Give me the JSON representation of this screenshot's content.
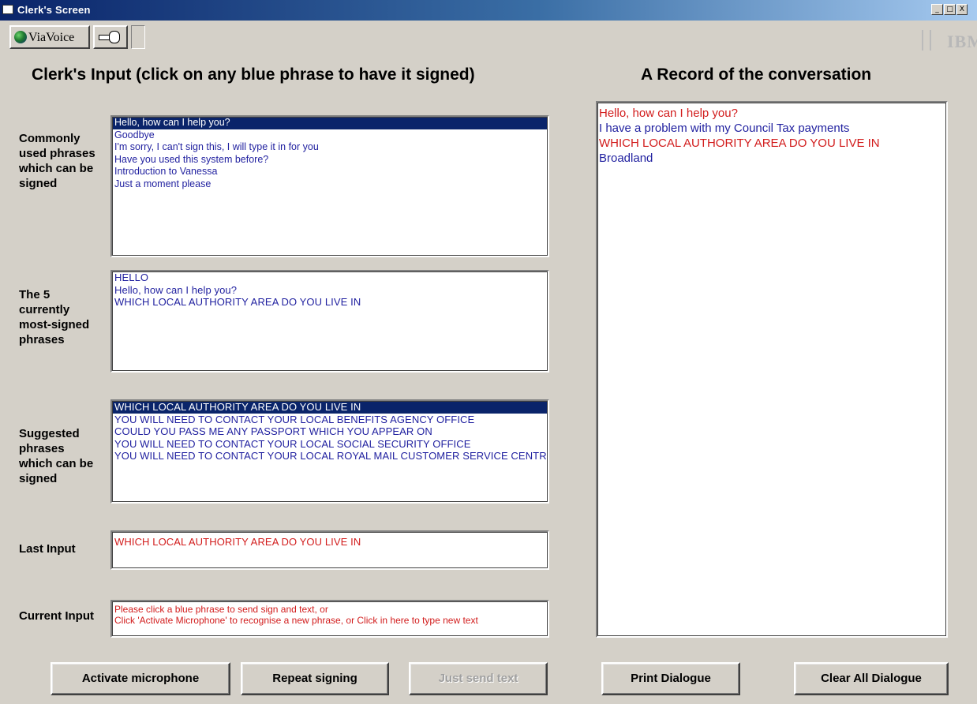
{
  "window": {
    "title": "Clerk's Screen",
    "controls": [
      "_",
      "□",
      "X"
    ]
  },
  "toolbar": {
    "viavoice_label": "ViaVoice",
    "logo_text": "IBM"
  },
  "headings": {
    "input": "Clerk's Input (click on any blue phrase to have it signed)",
    "record": "A Record of the conversation"
  },
  "sections": {
    "common": "Commonly used phrases which can be signed",
    "most_signed": "The 5 currently most-signed phrases",
    "suggested": "Suggested phrases which can be signed",
    "last_input": "Last Input",
    "current_input": "Current Input"
  },
  "common_phrases": [
    "Hello, how can I help you?",
    "Goodbye",
    "I'm sorry, I can't sign this, I will type it in for you",
    "Have you used this system before?",
    "Introduction to Vanessa",
    "Just a moment please"
  ],
  "most_signed": [
    "HELLO",
    "Hello, how can I help you?",
    "WHICH LOCAL AUTHORITY AREA DO YOU LIVE IN"
  ],
  "suggested": [
    "WHICH LOCAL AUTHORITY AREA DO YOU LIVE IN",
    "YOU WILL NEED TO CONTACT YOUR LOCAL BENEFITS AGENCY OFFICE",
    "COULD YOU PASS ME ANY PASSPORT WHICH YOU APPEAR ON",
    "YOU WILL NEED TO CONTACT YOUR LOCAL SOCIAL SECURITY OFFICE",
    "YOU WILL NEED TO CONTACT YOUR LOCAL ROYAL MAIL CUSTOMER SERVICE CENTRE"
  ],
  "last_input": "WHICH LOCAL AUTHORITY AREA DO YOU LIVE IN",
  "current_input": [
    "Please click a blue phrase to send sign and text, or",
    "Click 'Activate Microphone' to recognise a new phrase, or Click in here to type new text"
  ],
  "record": [
    {
      "text": "Hello, how can I help you?",
      "speaker": "clerk"
    },
    {
      "text": "I have a problem with my Council Tax payments",
      "speaker": "customer"
    },
    {
      "text": "WHICH LOCAL AUTHORITY AREA DO YOU LIVE IN",
      "speaker": "clerk"
    },
    {
      "text": "Broadland",
      "speaker": "customer"
    }
  ],
  "buttons": {
    "activate": "Activate microphone",
    "repeat": "Repeat signing",
    "send": "Just send text",
    "print": "Print Dialogue",
    "clear": "Clear All Dialogue"
  },
  "colors": {
    "selection": "#0a246a",
    "phrase_blue": "#1f1f9f",
    "clerk_red": "#d21c1c",
    "window_bg": "#d4d0c8"
  }
}
